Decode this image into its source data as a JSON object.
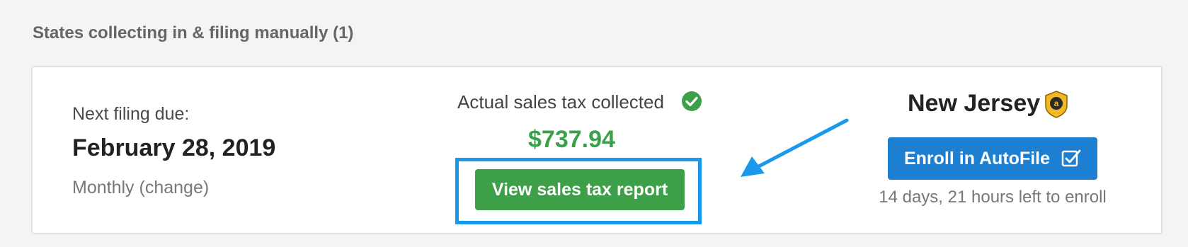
{
  "section": {
    "title": "States collecting in & filing manually (1)"
  },
  "filing": {
    "next_label": "Next filing due:",
    "due_date": "February 28, 2019",
    "frequency": "Monthly",
    "change_link": "(change)"
  },
  "collected": {
    "label": "Actual sales tax collected",
    "amount": "$737.94",
    "report_button": "View sales tax report"
  },
  "state": {
    "name": "New Jersey",
    "badge_icon": "amazon-badge-icon",
    "enroll_button": "Enroll in AutoFile",
    "time_left": "14 days, 21 hours left to enroll"
  },
  "colors": {
    "green": "#3d9f48",
    "amount_green": "#3aa14a",
    "blue": "#1d7fd1",
    "highlight_blue": "#1a98ec",
    "badge_gold": "#f2b724"
  }
}
